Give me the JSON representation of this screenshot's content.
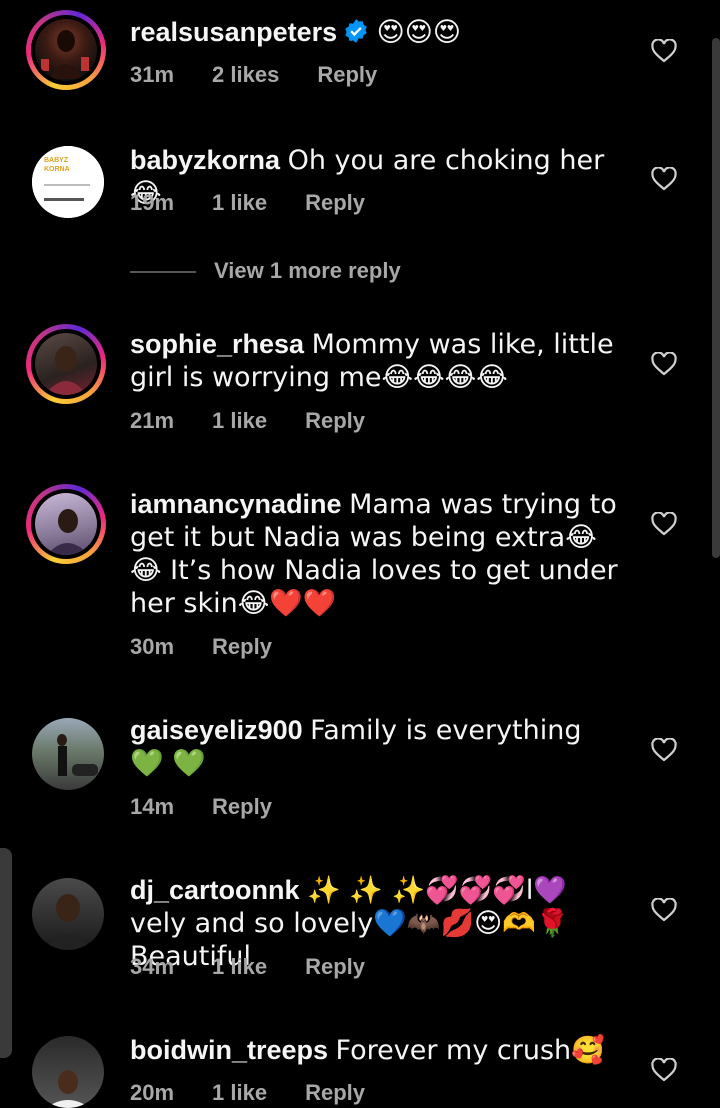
{
  "comments": [
    {
      "username": "realsusanpeters",
      "text": "😍😍😍",
      "time": "31m",
      "likes": "2 likes",
      "reply": "Reply",
      "verified": true
    },
    {
      "username": "babyzkorna",
      "text": "Oh you are choking her😂",
      "time": "19m",
      "likes": "1 like",
      "reply": "Reply"
    },
    {
      "username": "sophie_rhesa",
      "text": "Mommy was like,  little girl is worrying me😂😂😂😂",
      "time": "21m",
      "likes": "1 like",
      "reply": "Reply"
    },
    {
      "username": "iamnancynadine",
      "text": "Mama was trying to get it but Nadia was being extra😂😂 It’s how Nadia loves to get under her skin😂❤️❤️",
      "time": "30m",
      "likes": "",
      "reply": "Reply"
    },
    {
      "username": "gaiseyeliz900",
      "text": "Family is everything 💚 💚",
      "time": "14m",
      "likes": "",
      "reply": "Reply"
    },
    {
      "username": "dj_cartoonnk",
      "text": "✨ ✨ ✨💞💞💞l💜vely and so lovely💙🦇💋😍🫶🌹 Beautiful",
      "time": "34m",
      "likes": "1 like",
      "reply": "Reply"
    },
    {
      "username": "boidwin_treeps",
      "text": "Forever my  crush🥰",
      "time": "20m",
      "likes": "1 like",
      "reply": "Reply"
    }
  ],
  "view_more": "View 1 more reply",
  "avatar_texts": {
    "babyz": "BABYZ KORNA"
  },
  "colors": {
    "background": "#000000",
    "text": "#f5f5f5",
    "meta": "#a8a8a8",
    "verified": "#0095f6"
  },
  "icons": {
    "like": "heart-outline-icon",
    "verified": "verified-badge-icon"
  }
}
